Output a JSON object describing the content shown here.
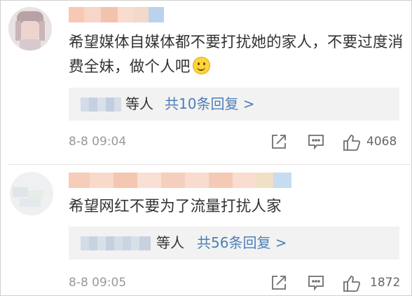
{
  "comments": [
    {
      "text": "希望媒体自媒体都不要打扰她的家人，不要过度消费全妹，做个人吧",
      "reply_people_suffix": "等人",
      "reply_count_text": "共10条回复 >",
      "timestamp": "8-8 09:04",
      "like_count": "4068"
    },
    {
      "text": "希望网红不要为了流量打扰人家",
      "reply_people_suffix": "等人",
      "reply_count_text": "共56条回复 >",
      "timestamp": "8-8 09:05",
      "like_count": "1872"
    }
  ],
  "icons": {
    "share": "share-icon",
    "comment": "comment-icon",
    "like": "thumbs-up-icon",
    "emoji": "smile-emoji-icon"
  },
  "colors": {
    "reply_link": "#4c7fb8",
    "timestamp": "#999999",
    "reply_box_bg": "#f2f2f2"
  }
}
